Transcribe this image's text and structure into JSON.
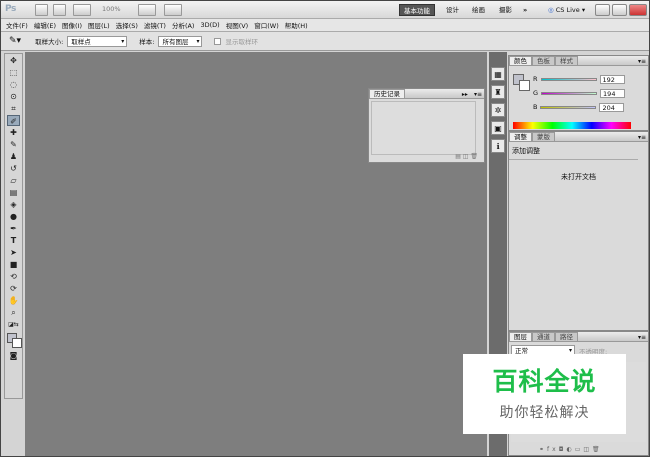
{
  "titlebar": {
    "logo": "Ps",
    "zoom": "100%",
    "workspaces": [
      "基本功能",
      "设计",
      "绘画",
      "摄影"
    ],
    "more": "»",
    "cs_live": "CS Live"
  },
  "menu": [
    "文件(F)",
    "编辑(E)",
    "图像(I)",
    "图层(L)",
    "选择(S)",
    "滤镜(T)",
    "分析(A)",
    "3D(D)",
    "视图(V)",
    "窗口(W)",
    "帮助(H)"
  ],
  "options": {
    "sample_size_label": "取样大小:",
    "sample_size_value": "取样点",
    "sample_label": "样本:",
    "sample_value": "所有图层",
    "show_ring": "显示取样环"
  },
  "history_panel": {
    "tab": "历史记录"
  },
  "color_panel": {
    "tabs": [
      "颜色",
      "色板",
      "样式"
    ],
    "r_label": "R",
    "r_value": "192",
    "g_label": "G",
    "g_value": "194",
    "b_label": "B",
    "b_value": "204",
    "swatch_color": "#c0c2cc"
  },
  "adjust_panel": {
    "tabs": [
      "调整",
      "蒙版"
    ],
    "title": "添加调整",
    "message": "未打开文档"
  },
  "layers_panel": {
    "tabs": [
      "图层",
      "通道",
      "路径"
    ],
    "blend_mode": "正常",
    "opacity_label": "不透明度:"
  },
  "watermark": {
    "line1": "百科全说",
    "line2": "助你轻松解决"
  }
}
